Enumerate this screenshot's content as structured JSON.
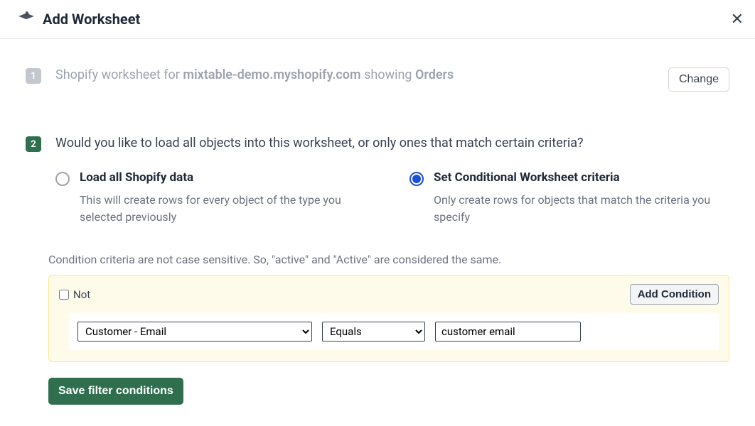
{
  "header": {
    "title": "Add Worksheet"
  },
  "step1": {
    "number": "1",
    "prefix": "Shopify worksheet for ",
    "domain": "mixtable-demo.myshopify.com",
    "middle": " showing ",
    "object": "Orders",
    "change_label": "Change"
  },
  "step2": {
    "number": "2",
    "question": "Would you like to load all objects into this worksheet, or only ones that match certain criteria?",
    "options": {
      "all": {
        "title": "Load all Shopify data",
        "desc": "This will create rows for every object of the type you selected previously"
      },
      "conditional": {
        "title": "Set Conditional Worksheet criteria",
        "desc": "Only create rows for objects that match the criteria you specify"
      }
    },
    "criteria_note": "Condition criteria are not case sensitive. So, \"active\" and \"Active\" are considered the same.",
    "not_label": "Not",
    "add_condition_label": "Add Condition",
    "condition": {
      "field": "Customer - Email",
      "operator": "Equals",
      "value": "customer email"
    },
    "save_label": "Save filter conditions"
  }
}
